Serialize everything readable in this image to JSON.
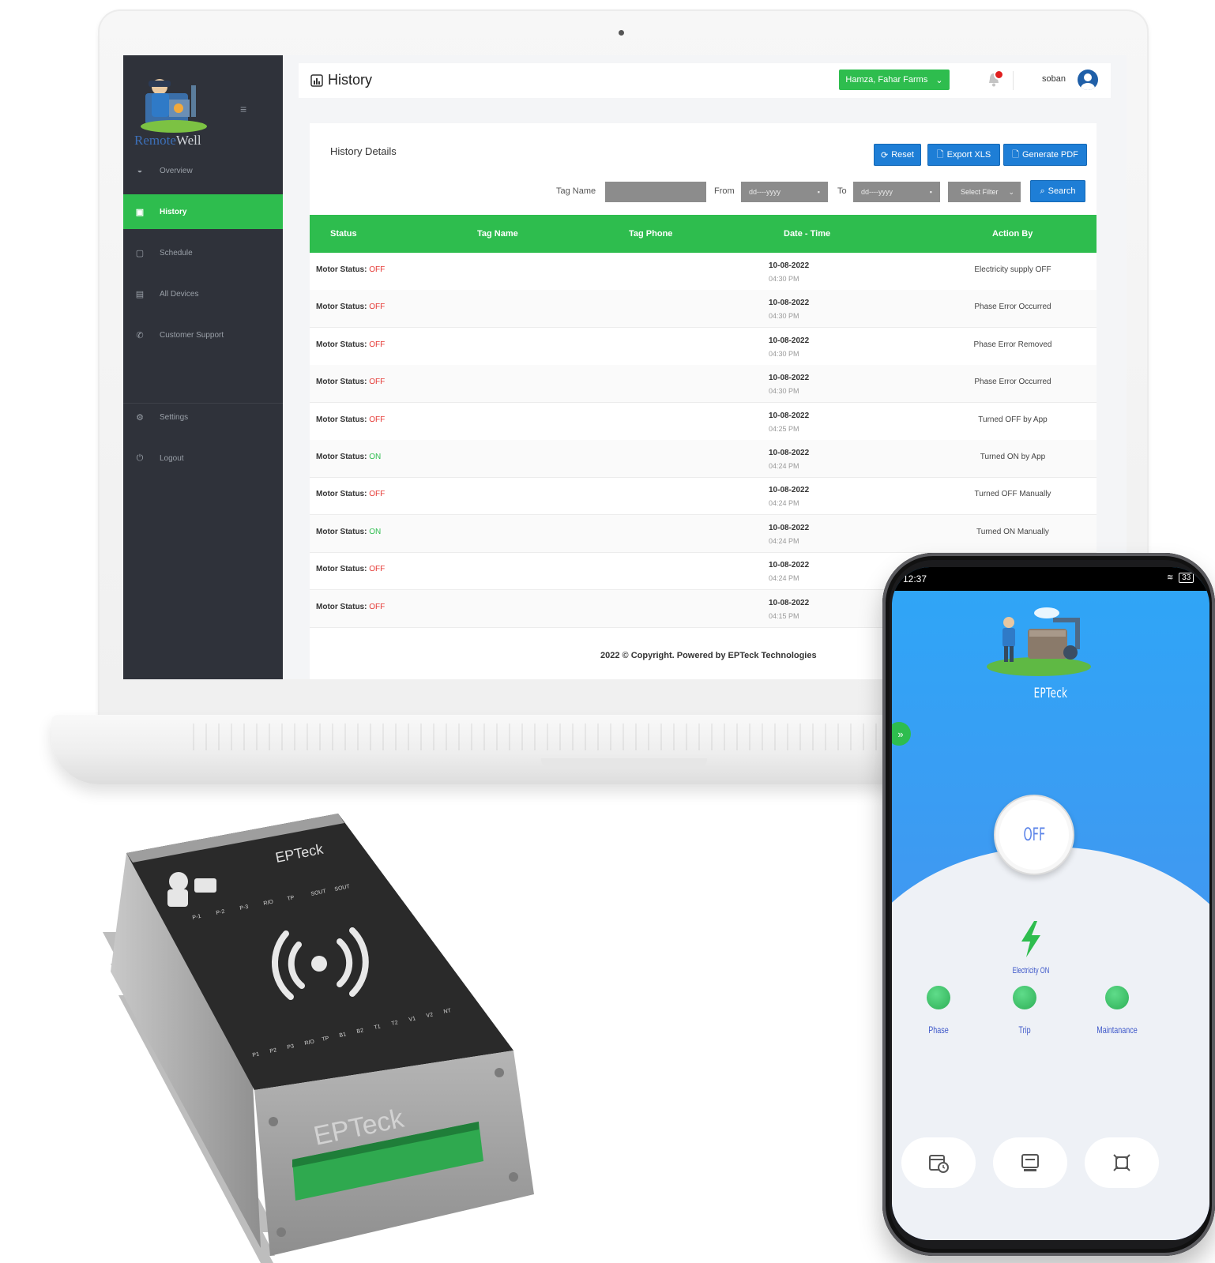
{
  "sidebar": {
    "logo_text_a": "Remote",
    "logo_text_b": "Well",
    "items": [
      {
        "label": "Overview"
      },
      {
        "label": "History"
      },
      {
        "label": "Schedule"
      },
      {
        "label": "All Devices"
      },
      {
        "label": "Customer Support"
      },
      {
        "label": "Settings"
      },
      {
        "label": "Logout"
      }
    ]
  },
  "header": {
    "title": "History",
    "farm_select": "Hamza, Fahar Farms",
    "user": "soban"
  },
  "history": {
    "card_title": "History Details",
    "reset_label": "Reset",
    "export_label": "Export XLS",
    "pdf_label": "Generate PDF",
    "tag_name_label": "Tag Name",
    "from_label": "From",
    "to_label": "To",
    "date_placeholder": "dd----yyyy",
    "select_filter": "Select Filter",
    "search_label": "Search",
    "columns": [
      "Status",
      "Tag Name",
      "Tag Phone",
      "Date - Time",
      "Action By"
    ],
    "status_prefix": "Motor Status:",
    "rows": [
      {
        "status": "OFF",
        "date": "10-08-2022",
        "time": "04:30 PM",
        "action": "Electricity supply OFF"
      },
      {
        "status": "OFF",
        "date": "10-08-2022",
        "time": "04:30 PM",
        "action": "Phase Error Occurred"
      },
      {
        "status": "OFF",
        "date": "10-08-2022",
        "time": "04:30 PM",
        "action": "Phase Error Removed"
      },
      {
        "status": "OFF",
        "date": "10-08-2022",
        "time": "04:30 PM",
        "action": "Phase Error Occurred"
      },
      {
        "status": "OFF",
        "date": "10-08-2022",
        "time": "04:25 PM",
        "action": "Turned OFF by App"
      },
      {
        "status": "ON",
        "date": "10-08-2022",
        "time": "04:24 PM",
        "action": "Turned ON by App"
      },
      {
        "status": "OFF",
        "date": "10-08-2022",
        "time": "04:24 PM",
        "action": "Turned OFF Manually"
      },
      {
        "status": "ON",
        "date": "10-08-2022",
        "time": "04:24 PM",
        "action": "Turned ON Manually"
      },
      {
        "status": "OFF",
        "date": "10-08-2022",
        "time": "04:24 PM",
        "action": ""
      },
      {
        "status": "OFF",
        "date": "10-08-2022",
        "time": "04:15 PM",
        "action": ""
      }
    ],
    "footer": "2022 © Copyright. Powered by EPTeck Technologies"
  },
  "device": {
    "brand_top": "EPTeck",
    "brand_front": "EPTeck",
    "labels_top": [
      "P-1",
      "P-2",
      "P-3",
      "R/O",
      "TP",
      "SOUT",
      "SOUT"
    ],
    "labels_bottom": [
      "P1",
      "P2",
      "P3",
      "R/O",
      "TP",
      "B1",
      "B2",
      "T1",
      "T2",
      "V1",
      "V2",
      "NT"
    ]
  },
  "phone": {
    "time": "12:37",
    "battery": "33",
    "app_title": "EPTeck",
    "power_state": "OFF",
    "electricity_label": "Electricity ON",
    "indicators": [
      {
        "label": "Phase"
      },
      {
        "label": "Trip"
      },
      {
        "label": "Maintanance"
      }
    ]
  },
  "colors": {
    "green": "#2ebd4e",
    "blue_button": "#1e7ed6",
    "sidebar": "#2f323a",
    "off_red": "#e53935"
  }
}
